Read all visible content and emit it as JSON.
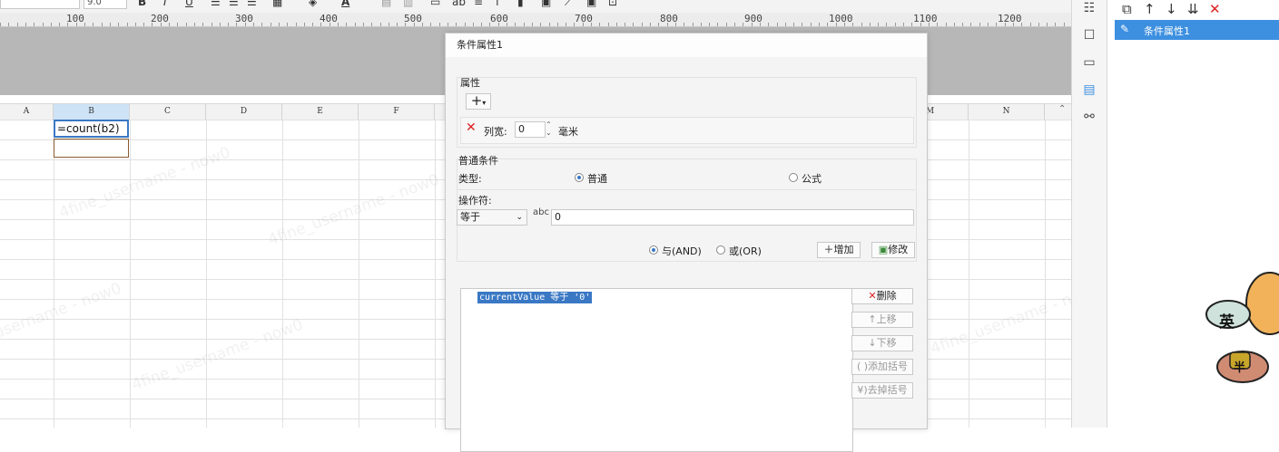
{
  "toolbar": {
    "font_size_value": "9.0",
    "bold_glyph": "B",
    "italic_glyph": "I",
    "underline_glyph": "U"
  },
  "ruler": {
    "labels": [
      "100",
      "200",
      "300",
      "400",
      "500",
      "600",
      "700",
      "800",
      "900",
      "1000",
      "1100",
      "1200"
    ]
  },
  "grid": {
    "columns": [
      "A",
      "B",
      "C",
      "D",
      "E",
      "F",
      "M",
      "N"
    ],
    "selected_column": "B",
    "active_cell_text": "=count(b2)",
    "watermark_text": "4fine_username - now0"
  },
  "dialog": {
    "title": "条件属性1",
    "properties_group": "属性",
    "add_property_glyph": "+",
    "column_width_label": "列宽:",
    "column_width_value": "0",
    "column_width_unit": "毫米",
    "condition_group": "普通条件",
    "type_label": "类型:",
    "type_normal": "普通",
    "type_formula": "公式",
    "operator_label": "操作符:",
    "operator_value": "等于",
    "operand_value": "0",
    "and_label": "与(AND)",
    "or_label": "或(OR)",
    "add_button": "增加",
    "modify_button": "修改",
    "delete_button": "删除",
    "move_up_button": "上移",
    "move_down_button": "下移",
    "add_bracket_button": "添加括号",
    "remove_bracket_button": "去掉括号",
    "condition_item": "currentValue 等于 '0'"
  },
  "right_panel": {
    "selected_item": "条件属性1"
  },
  "mascot": {
    "tag1": "英",
    "tag2": "半"
  },
  "colors": {
    "accent": "#3d8fe0",
    "danger": "#dd2222",
    "dialog_bg": "#f4f4f4"
  },
  "icons": [
    "cut-icon",
    "arrow-up-icon",
    "arrow-down-icon",
    "move-bottom-icon",
    "close-icon",
    "pencil-icon",
    "settings-icon",
    "square-icon",
    "frame-icon",
    "list-icon",
    "link-icon"
  ]
}
